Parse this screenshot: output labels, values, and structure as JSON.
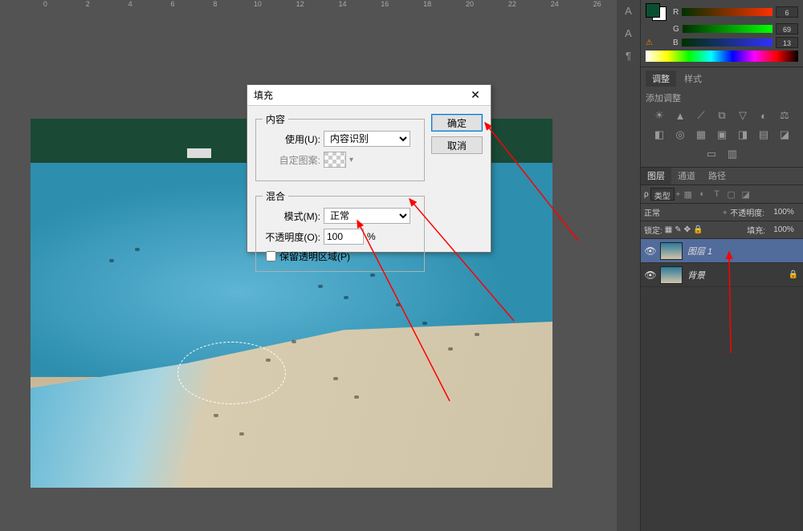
{
  "ruler_ticks": [
    "0",
    "2",
    "4",
    "6",
    "8",
    "10",
    "12",
    "14",
    "16",
    "18",
    "20",
    "22",
    "24",
    "26"
  ],
  "dialog": {
    "title": "填充",
    "ok": "确定",
    "cancel": "取消",
    "content": {
      "legend": "内容",
      "use_label": "使用(U):",
      "use_value": "内容识别",
      "pattern_label": "自定图案:"
    },
    "blend": {
      "legend": "混合",
      "mode_label": "模式(M):",
      "mode_value": "正常",
      "opacity_label": "不透明度(O):",
      "opacity_value": "100",
      "opacity_unit": "%",
      "preserve_label": "保留透明区域(P)"
    }
  },
  "color": {
    "r": "6",
    "g": "69",
    "b": "13"
  },
  "adjustments": {
    "tab_adjust": "调整",
    "tab_style": "样式",
    "label": "添加调整"
  },
  "layers": {
    "tab_layers": "图层",
    "tab_channels": "通道",
    "tab_paths": "路径",
    "filter_kind": "类型",
    "mode_normal": "正常",
    "opacity_label": "不透明度:",
    "opacity_value": "100%",
    "lock_label": "锁定:",
    "fill_label": "填充:",
    "fill_value": "100%",
    "items": [
      {
        "name": "图层 1",
        "selected": true
      },
      {
        "name": "背景",
        "selected": false
      }
    ]
  }
}
